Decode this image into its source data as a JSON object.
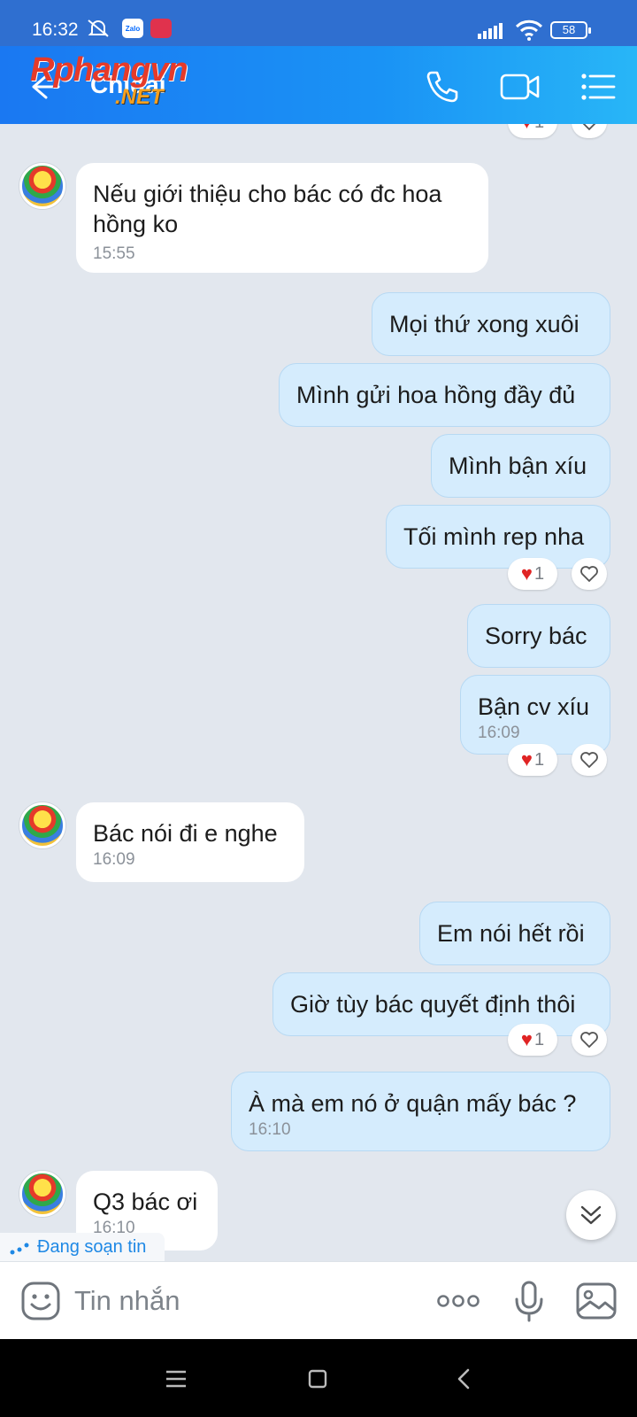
{
  "status_bar": {
    "time": "16:32",
    "battery": "58",
    "icons": [
      "mute-icon",
      "zalo-icon",
      "app-notification-icon",
      "signal-icon",
      "wifi-icon",
      "battery-icon"
    ]
  },
  "header": {
    "contact_name": "Chidai",
    "watermark_main": "Rphangvn",
    "watermark_sub": ".NET",
    "icons": [
      "back-arrow-icon",
      "phone-icon",
      "video-call-icon",
      "menu-list-icon"
    ],
    "gradient": [
      "#1a78f2",
      "#28b6f7"
    ]
  },
  "messages": [
    {
      "side": "in",
      "text": "Nếu giới thiệu cho bác có đc hoa hồng ko",
      "time": "15:55"
    },
    {
      "side": "out",
      "text": "Mọi thứ xong xuôi"
    },
    {
      "side": "out",
      "text": "Mình gửi hoa hồng đầy đủ"
    },
    {
      "side": "out",
      "text": "Mình bận xíu"
    },
    {
      "side": "out",
      "text": "Tối mình rep nha",
      "reaction_count": "1"
    },
    {
      "side": "out",
      "text": "Sorry bác"
    },
    {
      "side": "out",
      "text": "Bận cv xíu",
      "time": "16:09",
      "reaction_count": "1"
    },
    {
      "side": "in",
      "text": "Bác nói đi e nghe",
      "time": "16:09"
    },
    {
      "side": "out",
      "text": "Em nói hết rồi"
    },
    {
      "side": "out",
      "text": "Giờ tùy bác quyết định thôi",
      "reaction_count": "1"
    },
    {
      "side": "out",
      "text": "À mà em nó ở quận mấy bác ?",
      "time": "16:10"
    },
    {
      "side": "in",
      "text": "Q3 bác ơi",
      "time": "16:10"
    }
  ],
  "top_reaction_count": "1",
  "typing_indicator": "Đang soạn tin",
  "composer": {
    "placeholder": "Tin nhắn",
    "icons": [
      "sticker-emoji-icon",
      "more-options-icon",
      "microphone-icon",
      "image-gallery-icon"
    ]
  },
  "colors": {
    "outgoing_bubble": "#d5ecfd",
    "incoming_bubble": "#ffffff",
    "chat_background": "#e2e7ee",
    "reaction_heart": "#e02424",
    "typing_text": "#1e88e5"
  }
}
